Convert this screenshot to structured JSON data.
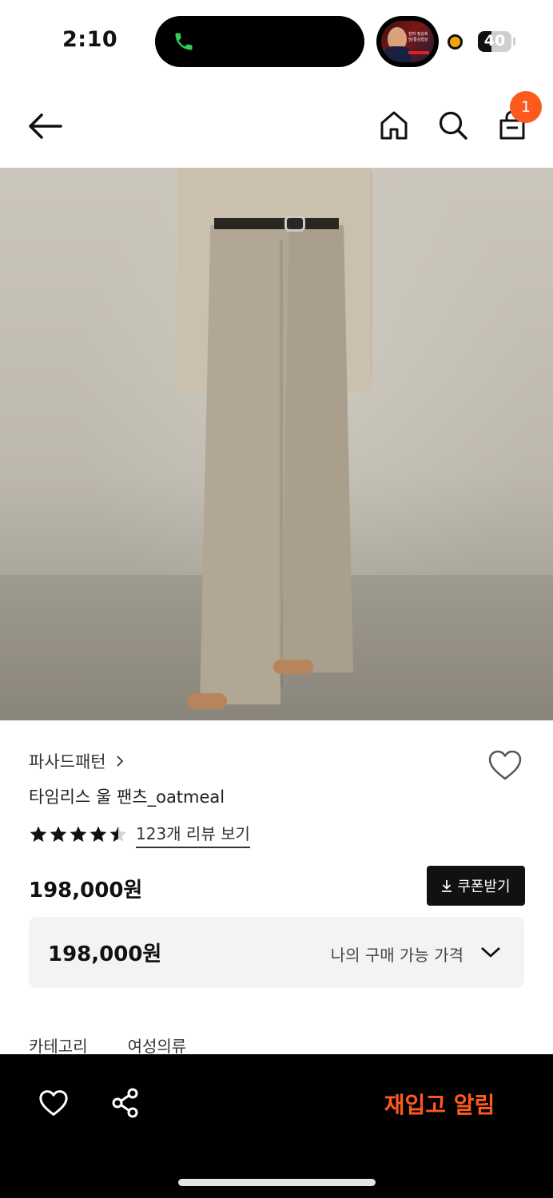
{
  "status_bar": {
    "time": "2:10",
    "battery_level": "40",
    "battery_fraction": 0.4,
    "call_icon": "phone-icon",
    "live_activity": {
      "headline": "한미 정상회담/통상협상",
      "subline": "미국 동시 라이브"
    }
  },
  "header": {
    "back_icon": "arrow-left-icon",
    "home_icon": "home-icon",
    "search_icon": "search-icon",
    "cart_icon": "shopping-bag-icon",
    "cart_count": "1"
  },
  "product": {
    "brand": "파사드패턴",
    "name": "타임리스 울 팬츠_oatmeal",
    "rating": 4.5,
    "rating_max": 5,
    "review_link": "123개 리뷰 보기",
    "price": "198,000원",
    "coupon_button": "쿠폰받기",
    "my_price": "198,000원",
    "my_price_label": "나의 구매 가능 가격",
    "category_label": "카테고리",
    "category_value": "여성의류"
  },
  "bottom_bar": {
    "restock_button": "재입고 알림"
  },
  "colors": {
    "accent": "#ff5a1e",
    "bottom_bar": "#000000",
    "price_box": "#f3f3f3"
  }
}
